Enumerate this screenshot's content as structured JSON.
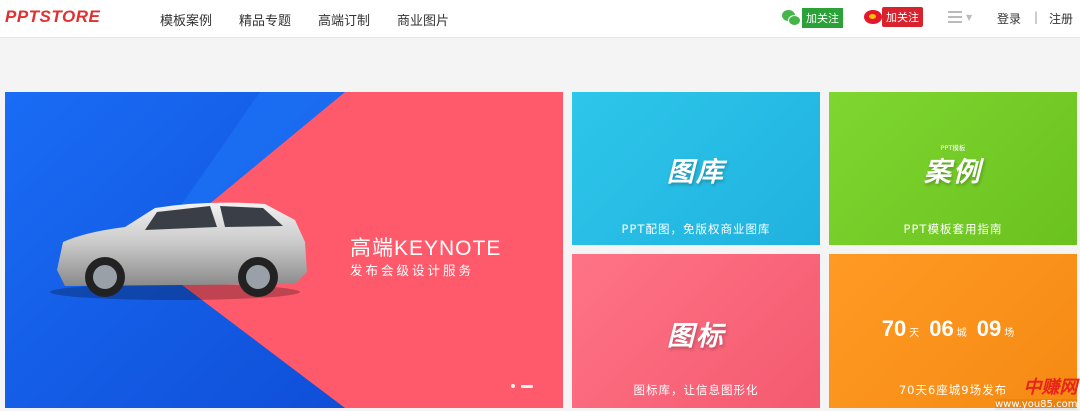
{
  "header": {
    "logo": "PPTSTORE",
    "nav": [
      "模板案例",
      "精品专题",
      "高端订制",
      "商业图片"
    ],
    "wechat_follow": "加关注",
    "weibo_follow": "加关注",
    "login": "登录",
    "separator": "|",
    "register": "注册"
  },
  "banner": {
    "title": "高端KEYNOTE",
    "subtitle": "发布会级设计服务",
    "slides": 2,
    "active_slide": 2
  },
  "tiles": [
    {
      "title": "图库",
      "caption": "PPT配图，免版权商业图库",
      "color": "#2ec6ea"
    },
    {
      "small": "PPT模板",
      "title": "案例",
      "caption": "PPT模板套用指南",
      "color": "#7fd630"
    },
    {
      "title": "图标",
      "caption": "图标库，让信息图形化",
      "color": "#ff7386"
    },
    {
      "caption": "70天6座城9场发布",
      "color": "#ff9a24",
      "countdown": [
        {
          "num": "70",
          "unit": "天"
        },
        {
          "num": "06",
          "unit": "城"
        },
        {
          "num": "09",
          "unit": "场"
        }
      ]
    }
  ],
  "watermark": {
    "main": "中赚网",
    "url": "www.you85.com"
  },
  "colors": {
    "accent_red": "#e03030",
    "banner_blue": "#1565f0",
    "banner_pink": "#ff5a6b"
  },
  "icons": [
    "wechat-icon",
    "weibo-icon",
    "menu-icon"
  ]
}
